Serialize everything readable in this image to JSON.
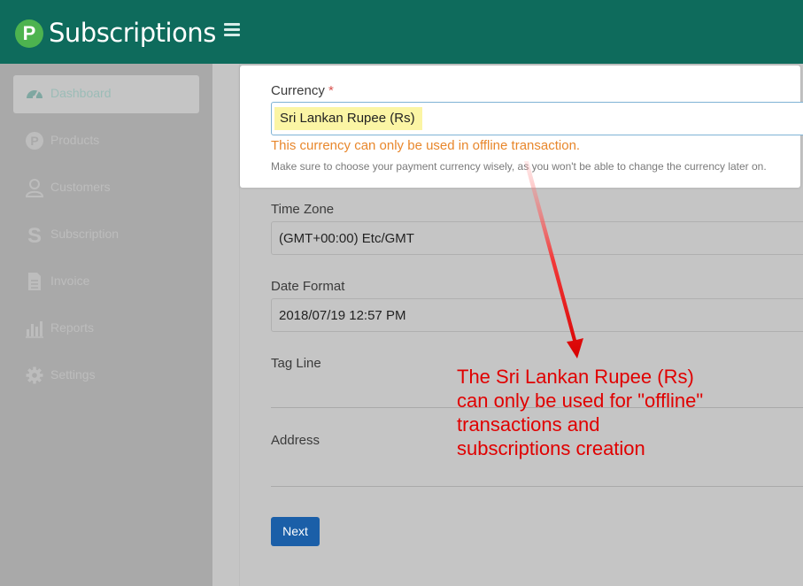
{
  "header": {
    "app_title": "Subscriptions",
    "logo_letter": "P"
  },
  "sidebar": {
    "items": [
      {
        "label": "Dashboard",
        "icon": "dashboard-gauge-icon",
        "active": true
      },
      {
        "label": "Products",
        "icon": "products-p-icon"
      },
      {
        "label": "Customers",
        "icon": "customers-user-icon"
      },
      {
        "label": "Subscription",
        "icon": "subscription-s-icon"
      },
      {
        "label": "Invoice",
        "icon": "invoice-document-icon"
      },
      {
        "label": "Reports",
        "icon": "reports-bar-chart-icon"
      },
      {
        "label": "Settings",
        "icon": "settings-gear-icon"
      }
    ]
  },
  "form": {
    "currency": {
      "label": "Currency",
      "required_mark": "*",
      "value": "Sri Lankan Rupee (Rs)",
      "warning": "This currency can only be used in offline transaction.",
      "hint": "Make sure to choose your payment currency wisely, as you won't be able to change the currency later on."
    },
    "time_zone": {
      "label": "Time Zone",
      "value": "(GMT+00:00) Etc/GMT"
    },
    "date_format": {
      "label": "Date Format",
      "value": "2018/07/19 12:57 PM"
    },
    "tag_line": {
      "label": "Tag Line",
      "value": ""
    },
    "address": {
      "label": "Address",
      "value": ""
    },
    "next_label": "Next"
  },
  "annotation": {
    "lines": [
      "The Sri Lankan Rupee (Rs)",
      "can only be used for \"offline\"",
      "transactions and",
      "subscriptions creation"
    ],
    "color": "#e00000"
  },
  "colors": {
    "header": "#0e6b5c",
    "logo": "#4db34f",
    "primary_button": "#1b5fa8",
    "warning": "#e8872c"
  }
}
